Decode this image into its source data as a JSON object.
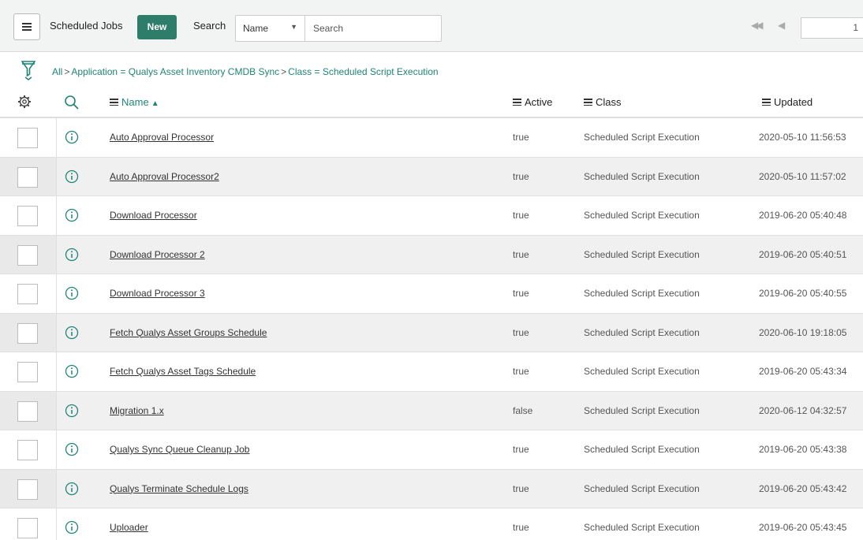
{
  "header": {
    "title": "Scheduled Jobs",
    "new_label": "New",
    "search_label": "Search",
    "search_field": "Name",
    "search_placeholder": "Search",
    "page_number": "1"
  },
  "breadcrumb": {
    "all": "All",
    "crumb1": "Application = Qualys Asset Inventory CMDB Sync",
    "crumb2": "Class = Scheduled Script Execution",
    "separator": ">"
  },
  "columns": {
    "name": "Name",
    "active": "Active",
    "class": "Class",
    "updated": "Updated"
  },
  "rows": [
    {
      "name": "Auto Approval Processor",
      "active": "true",
      "class": "Scheduled Script Execution",
      "updated": "2020-05-10 11:56:53"
    },
    {
      "name": "Auto Approval Processor2",
      "active": "true",
      "class": "Scheduled Script Execution",
      "updated": "2020-05-10 11:57:02"
    },
    {
      "name": "Download Processor",
      "active": "true",
      "class": "Scheduled Script Execution",
      "updated": "2019-06-20 05:40:48"
    },
    {
      "name": "Download Processor 2",
      "active": "true",
      "class": "Scheduled Script Execution",
      "updated": "2019-06-20 05:40:51"
    },
    {
      "name": "Download Processor 3",
      "active": "true",
      "class": "Scheduled Script Execution",
      "updated": "2019-06-20 05:40:55"
    },
    {
      "name": "Fetch Qualys Asset Groups Schedule",
      "active": "true",
      "class": "Scheduled Script Execution",
      "updated": "2020-06-10 19:18:05"
    },
    {
      "name": "Fetch Qualys Asset Tags Schedule",
      "active": "true",
      "class": "Scheduled Script Execution",
      "updated": "2019-06-20 05:43:34"
    },
    {
      "name": "Migration 1.x",
      "active": "false",
      "class": "Scheduled Script Execution",
      "updated": "2020-06-12 04:32:57"
    },
    {
      "name": "Qualys Sync Queue Cleanup Job",
      "active": "true",
      "class": "Scheduled Script Execution",
      "updated": "2019-06-20 05:43:38"
    },
    {
      "name": "Qualys Terminate Schedule Logs",
      "active": "true",
      "class": "Scheduled Script Execution",
      "updated": "2019-06-20 05:43:42"
    },
    {
      "name": "Uploader",
      "active": "true",
      "class": "Scheduled Script Execution",
      "updated": "2019-06-20 05:43:45"
    }
  ],
  "colors": {
    "accent": "#1f8476",
    "new_button": "#2e7d6b"
  }
}
